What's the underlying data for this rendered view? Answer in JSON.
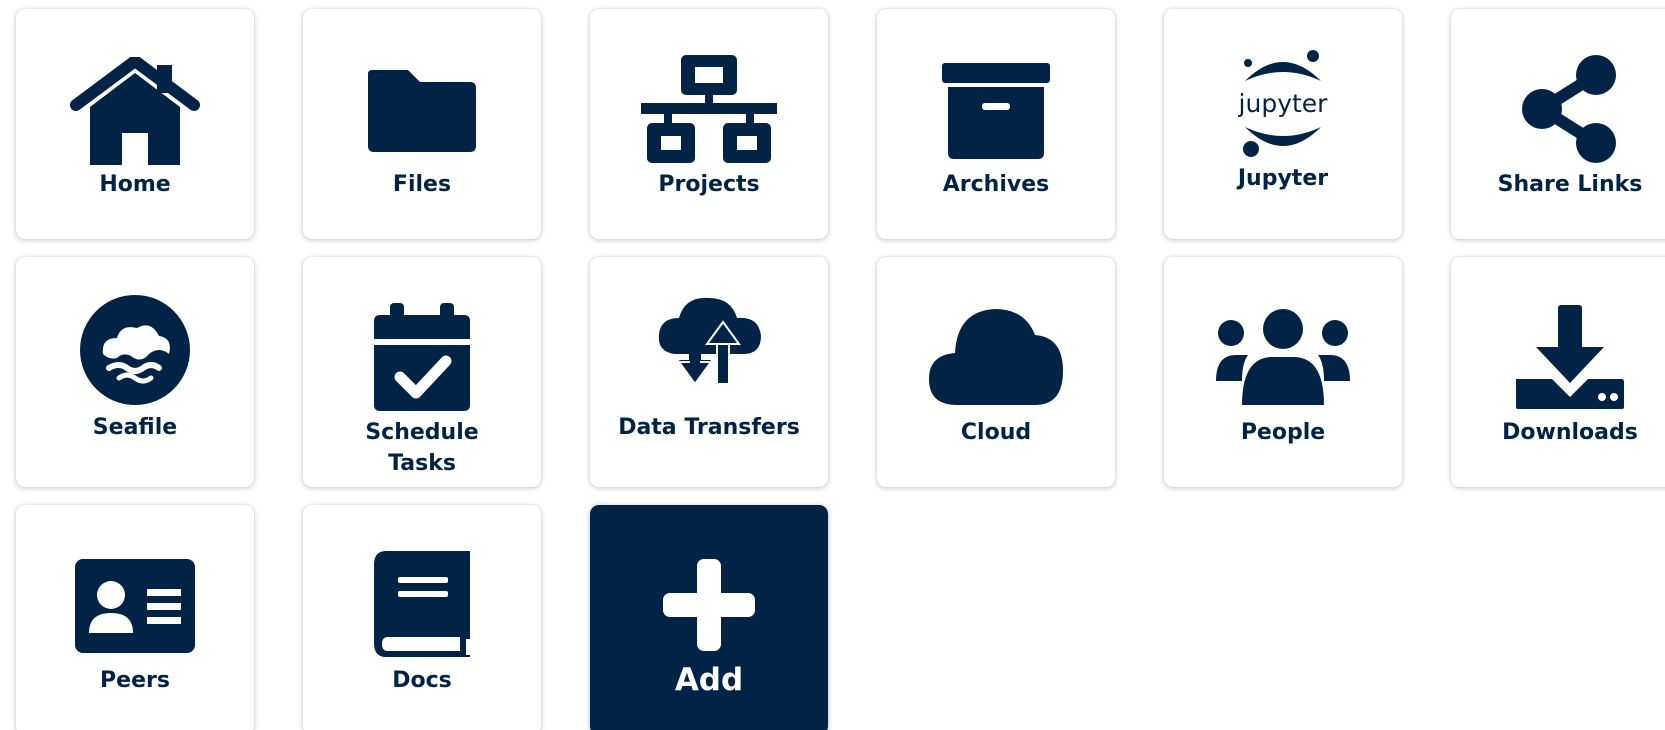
{
  "tiles": [
    {
      "label": "Home",
      "icon": "home-icon"
    },
    {
      "label": "Files",
      "icon": "folder-icon"
    },
    {
      "label": "Projects",
      "icon": "network-icon"
    },
    {
      "label": "Archives",
      "icon": "archive-box-icon"
    },
    {
      "label": "Jupyter",
      "icon": "jupyter-logo-icon",
      "logo_text": "jupyter"
    },
    {
      "label": "Share Links",
      "icon": "share-icon"
    },
    {
      "label": "Seafile",
      "icon": "seafile-logo-icon"
    },
    {
      "label": "Schedule\nTasks",
      "icon": "calendar-check-icon"
    },
    {
      "label": "Data Transfers",
      "icon": "cloud-transfer-icon"
    },
    {
      "label": "Cloud",
      "icon": "cloud-icon"
    },
    {
      "label": "People",
      "icon": "people-group-icon"
    },
    {
      "label": "Downloads",
      "icon": "download-tray-icon"
    },
    {
      "label": "Peers",
      "icon": "id-card-icon"
    },
    {
      "label": "Docs",
      "icon": "book-icon"
    },
    {
      "label": "Add",
      "icon": "plus-icon"
    }
  ],
  "colors": {
    "primary": "#012346",
    "tile_background": "#ffffff",
    "add_tile_text": "#ffffff"
  }
}
